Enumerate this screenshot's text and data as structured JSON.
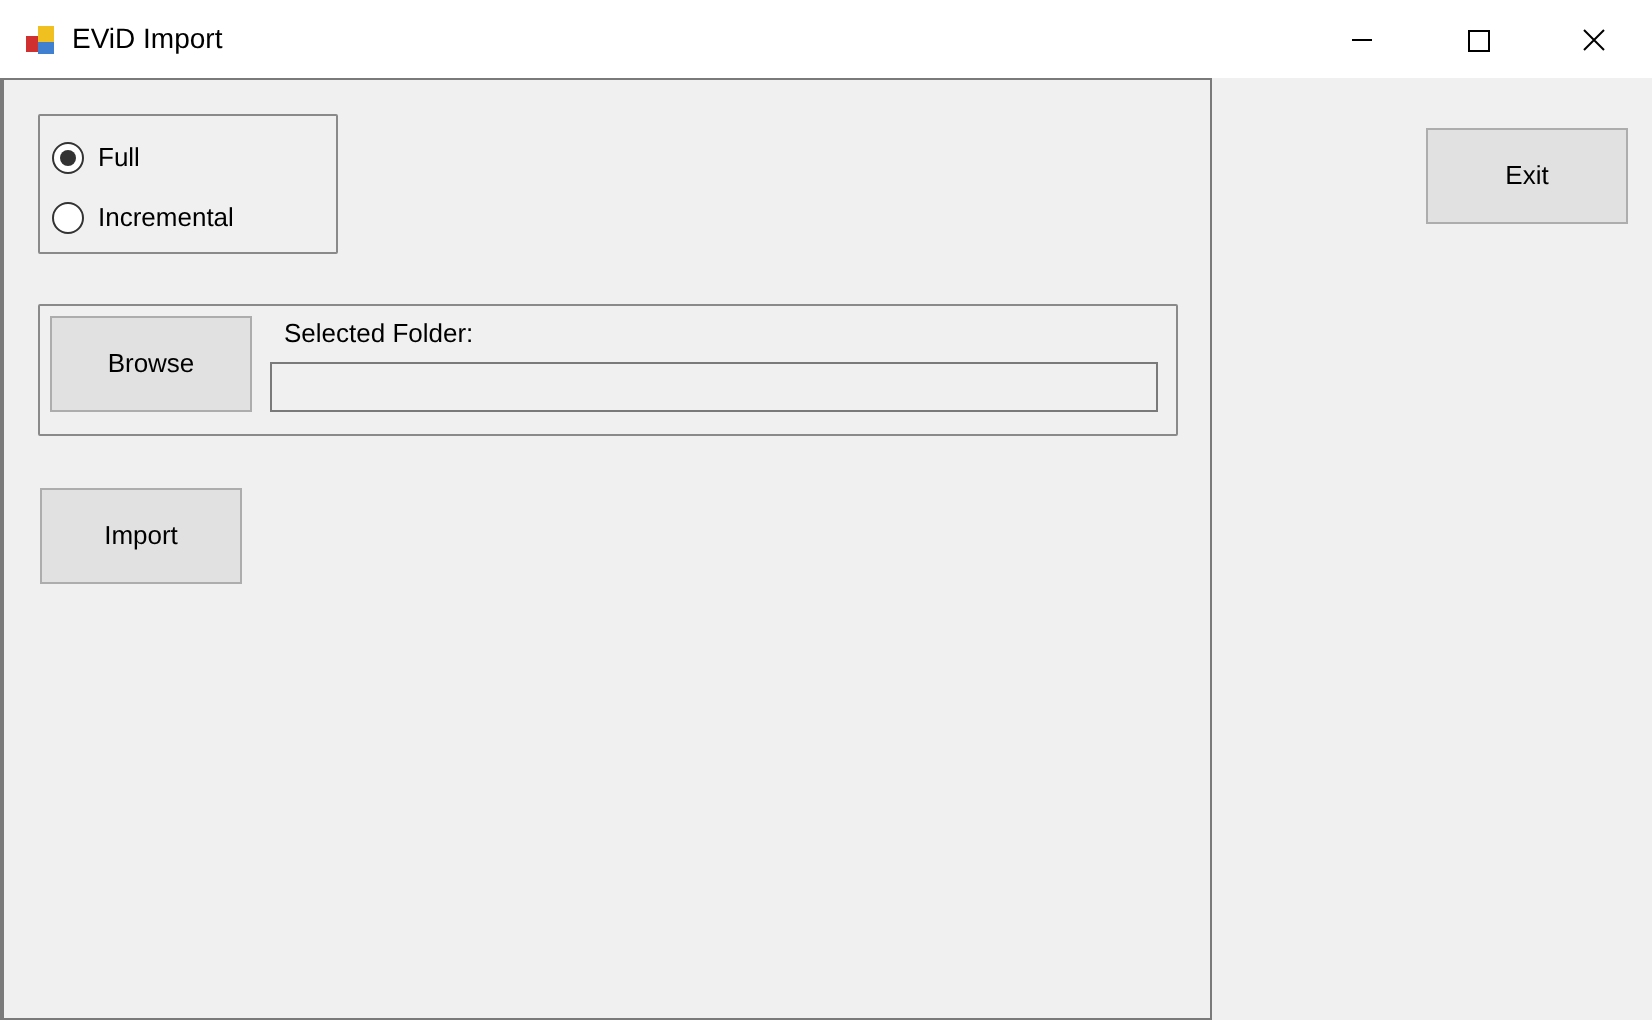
{
  "window": {
    "title": "EViD Import"
  },
  "mode_options": [
    {
      "label": "Full",
      "selected": true
    },
    {
      "label": "Incremental",
      "selected": false
    }
  ],
  "browse_button": "Browse",
  "folder": {
    "label": "Selected Folder:"
  },
  "import_button": "Import",
  "exit_button": "Exit"
}
